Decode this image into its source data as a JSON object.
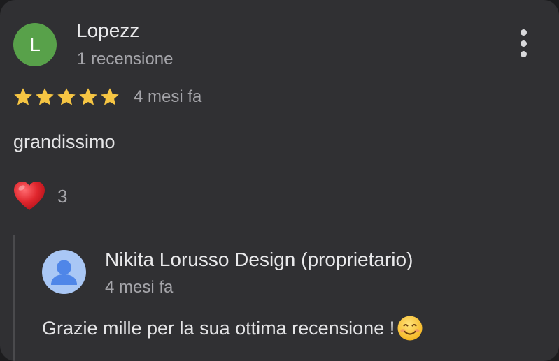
{
  "review": {
    "author": {
      "initial": "L",
      "name": "Lopezz",
      "meta": "1 recensione",
      "avatar_color": "#58a14a"
    },
    "more_icon": "more-vertical-icon",
    "rating": 5,
    "rating_max": 5,
    "time": "4 mesi fa",
    "text": "grandissimo",
    "reaction": {
      "icon": "heart-icon",
      "count": "3"
    }
  },
  "owner_reply": {
    "avatar_icon": "person-icon",
    "name": "Nikita Lorusso Design (proprietario)",
    "time": "4 mesi fa",
    "text": "Grazie mille per la sua ottima recensione !",
    "emoji_icon": "smiling-face-icon"
  },
  "colors": {
    "card_background": "#303033",
    "star": "#f6c543",
    "heart": "#e0262d",
    "owner_avatar": "#a9c7f5",
    "owner_avatar_figure": "#4f86e8"
  }
}
